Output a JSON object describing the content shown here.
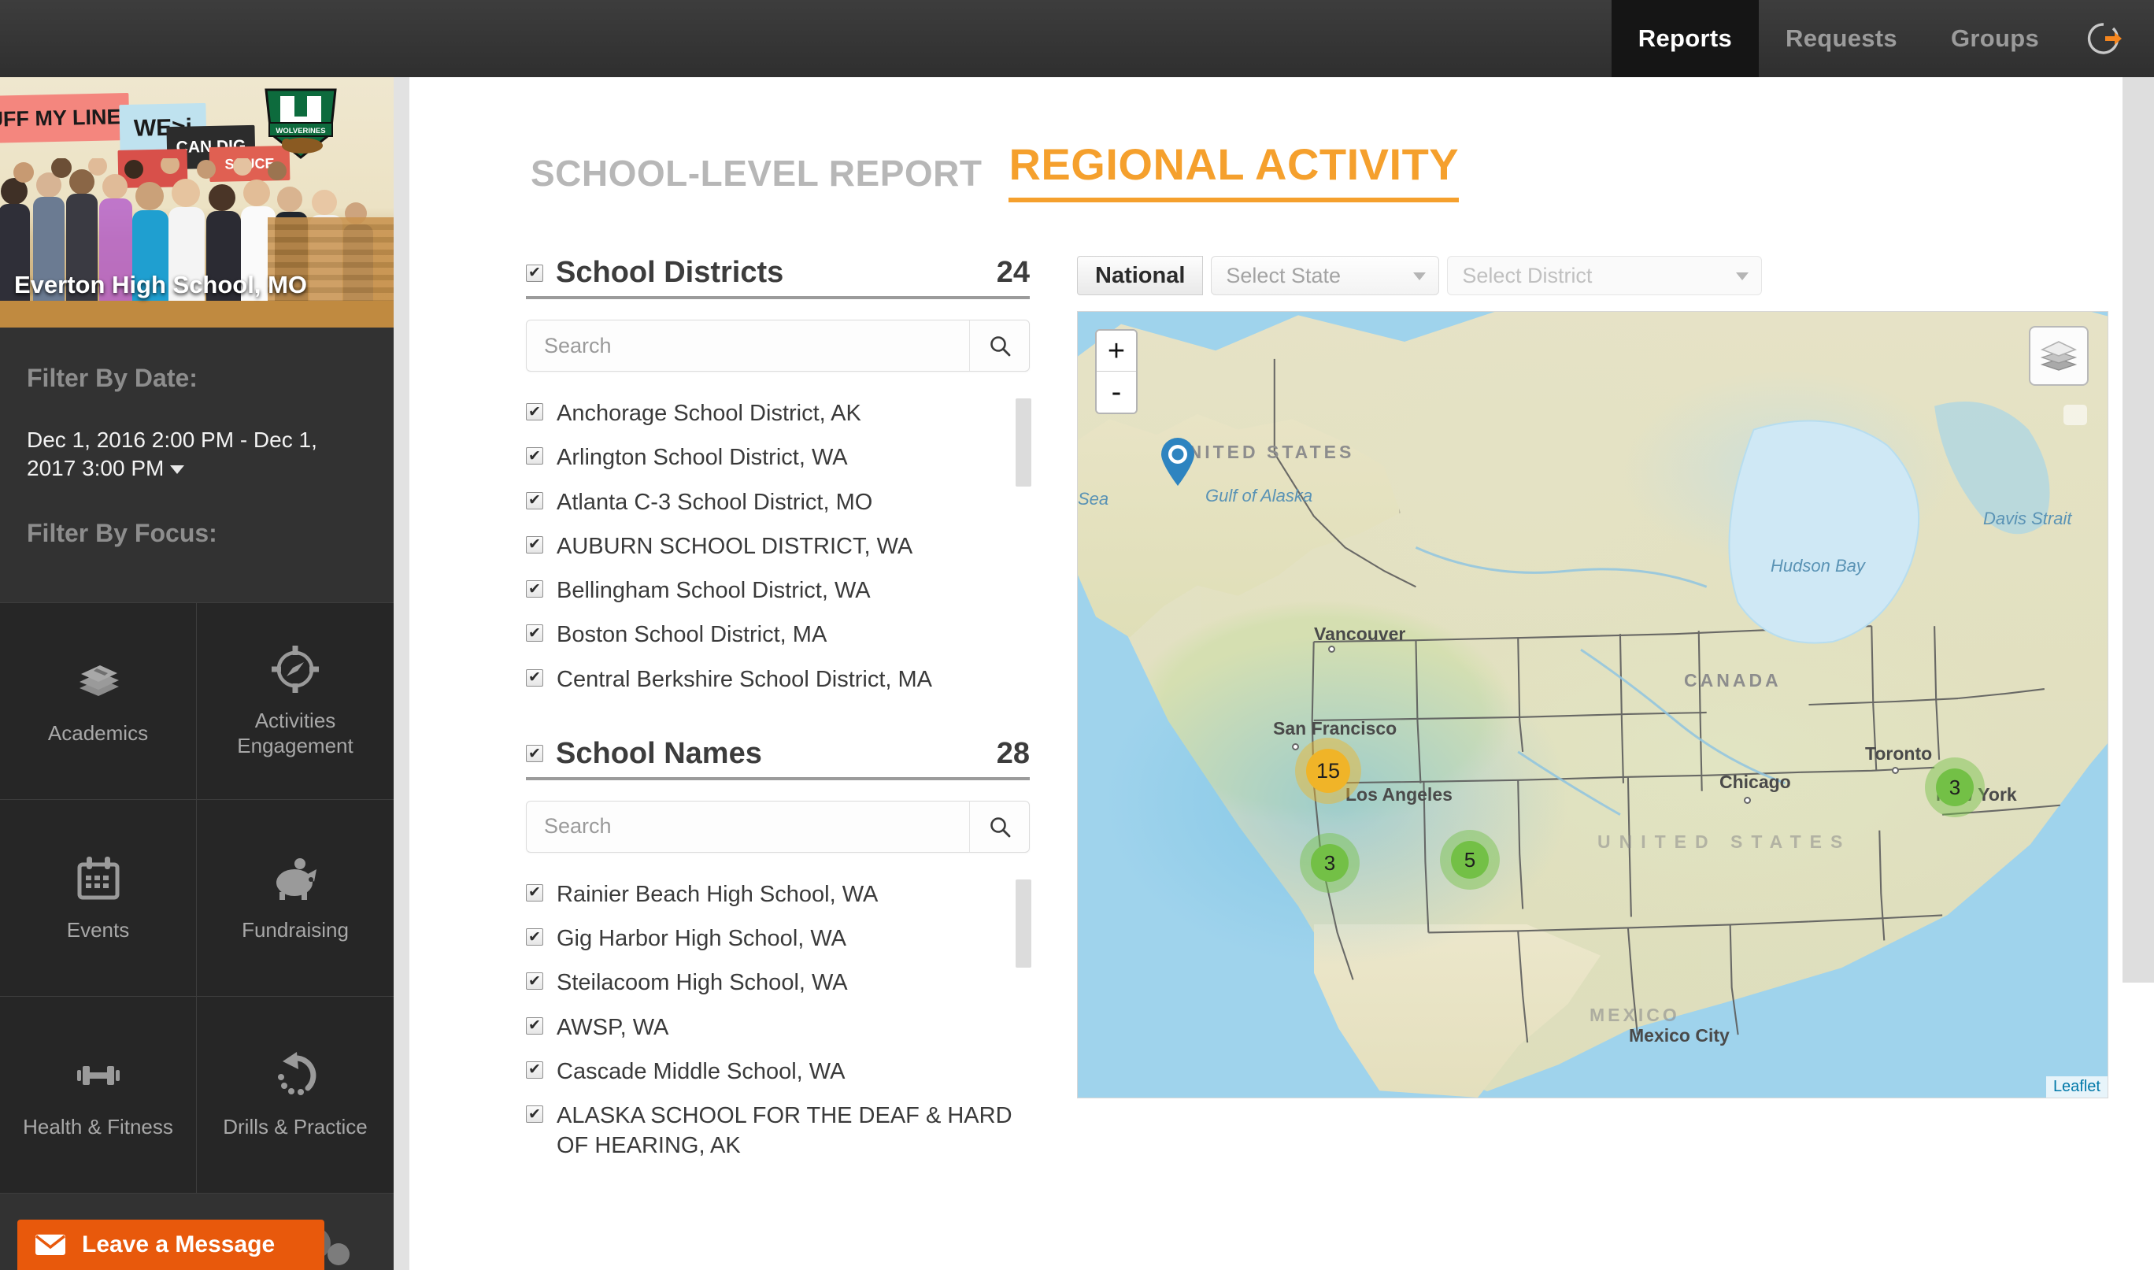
{
  "topnav": {
    "items": [
      {
        "label": "Reports",
        "active": true
      },
      {
        "label": "Requests",
        "active": false
      },
      {
        "label": "Groups",
        "active": false
      }
    ],
    "logout_icon": "logout-icon",
    "accent": "#f5861f",
    "bg": "#333333"
  },
  "sidebar": {
    "school_photo_caption": "Everton High School, MO",
    "photo_banners": [
      "UFF MY LINE",
      "WE>i",
      "CAN DIG",
      "SAUCE"
    ],
    "photo_logo_text": "WOLVERINES",
    "filter_date_label": "Filter By Date:",
    "date_range": "Dec 1, 2016 2:00 PM - Dec 1, 2017 3:00 PM",
    "filter_focus_label": "Filter By Focus:",
    "focus_tiles": [
      {
        "label": "Academics",
        "icon": "books-icon"
      },
      {
        "label": "Activities Engagement",
        "icon": "target-compass-icon"
      },
      {
        "label": "Events",
        "icon": "calendar-icon"
      },
      {
        "label": "Fundraising",
        "icon": "piggy-bank-icon"
      },
      {
        "label": "Health & Fitness",
        "icon": "dumbbell-icon"
      },
      {
        "label": "Drills & Practice",
        "icon": "refresh-arrow-icon"
      }
    ],
    "leave_message": "Leave a Message",
    "leave_message_icon": "envelope-icon",
    "leave_message_color": "#e8590c"
  },
  "main": {
    "tabs": [
      {
        "label": "SCHOOL-LEVEL REPORT",
        "active": false
      },
      {
        "label": "REGIONAL ACTIVITY",
        "active": true
      }
    ],
    "accent": "#f5a02d",
    "facets": [
      {
        "title": "School Districts",
        "count": "24",
        "checked": true,
        "search_placeholder": "Search",
        "items": [
          "Anchorage School District, AK",
          "Arlington School District, WA",
          "Atlanta C-3 School District, MO",
          "AUBURN SCHOOL DISTRICT, WA",
          "Bellingham School District, WA",
          "Boston School District, MA",
          "Central Berkshire School District, MA"
        ]
      },
      {
        "title": "School Names",
        "count": "28",
        "checked": true,
        "search_placeholder": "Search",
        "items": [
          "Rainier Beach High School, WA",
          "Gig Harbor High School, WA",
          "Steilacoom High School, WA",
          "AWSP, WA",
          "Cascade Middle School, WA",
          "ALASKA SCHOOL FOR THE DEAF & HARD OF HEARING, AK"
        ]
      }
    ],
    "map_controls": {
      "national_label": "National",
      "state_placeholder": "Select State",
      "district_placeholder": "Select District"
    },
    "map": {
      "zoom_in": "+",
      "zoom_out": "-",
      "layers_icon": "layers-icon",
      "attribution": "Leaflet",
      "pin_icon": "map-pin-icon",
      "clusters": [
        {
          "count": "15",
          "color": "#f0b429"
        },
        {
          "count": "3",
          "color": "#74c046"
        },
        {
          "count": "5",
          "color": "#74c046"
        },
        {
          "count": "3",
          "color": "#74c046"
        }
      ],
      "labels": {
        "countries": [
          "UNITED STATES",
          "CANADA",
          "UNITED  STATES",
          "MEXICO"
        ],
        "seas": [
          "Davis Strait",
          "Hudson Bay",
          "Gulf of Alaska",
          "Sea"
        ],
        "cities": [
          "Vancouver",
          "San Francisco",
          "Los Angeles",
          "Chicago",
          "Toronto",
          "New York",
          "Mexico City"
        ]
      }
    }
  }
}
